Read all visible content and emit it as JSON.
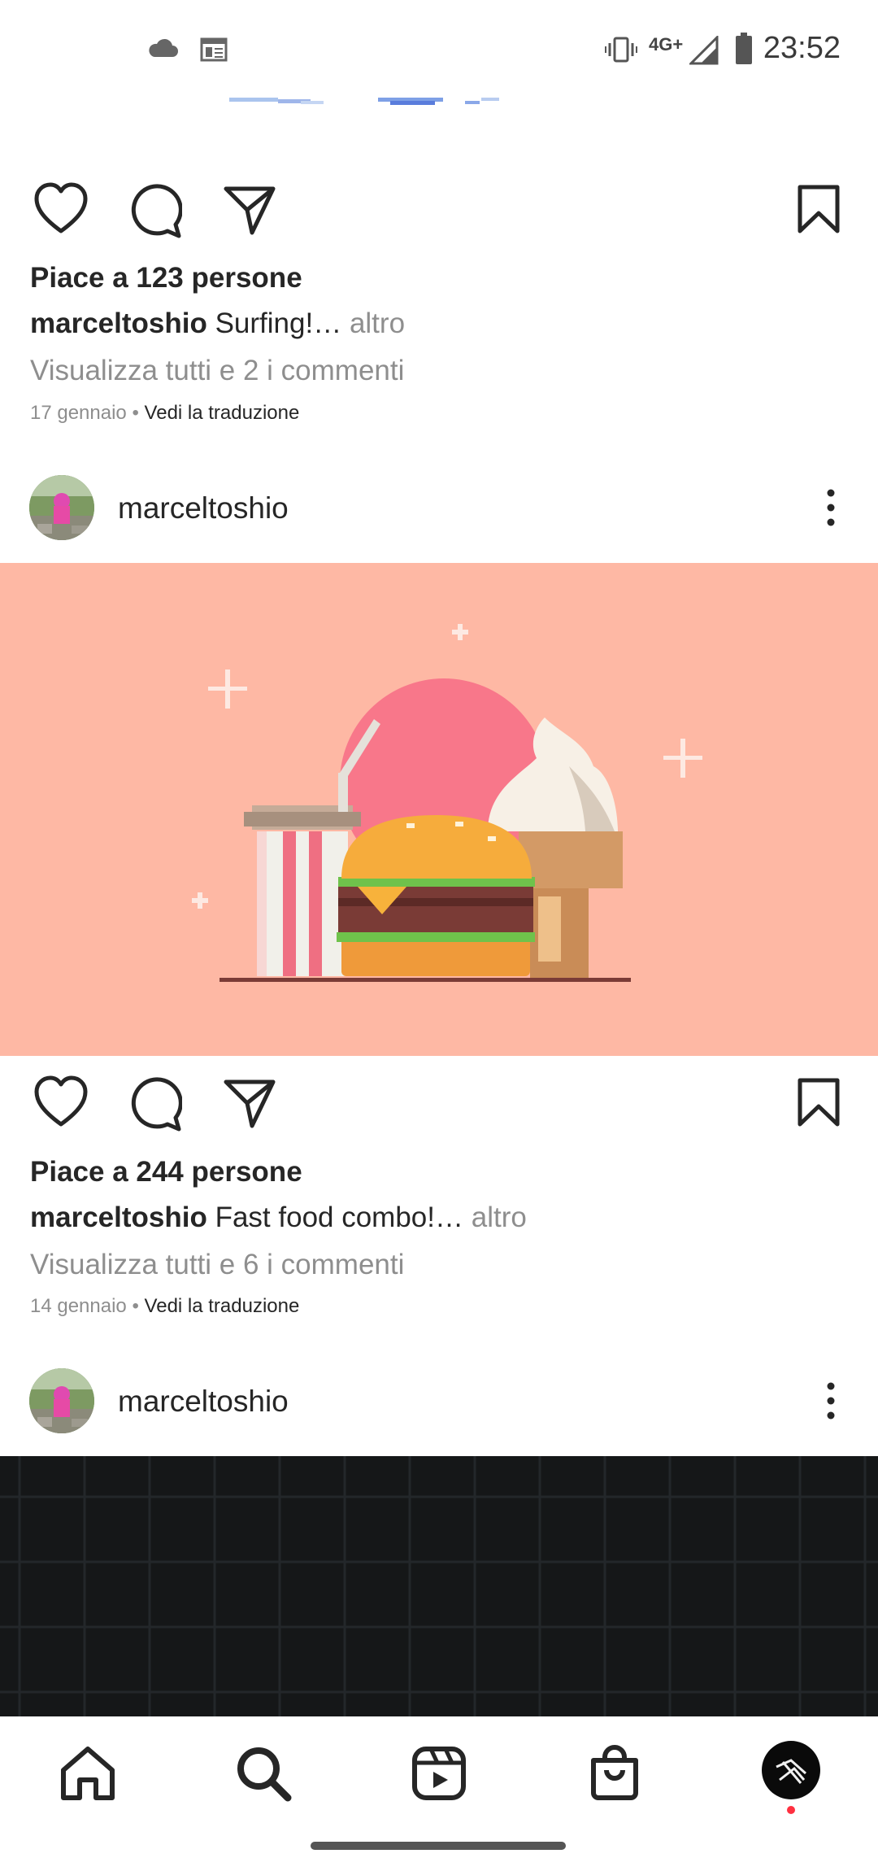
{
  "status_bar": {
    "time": "23:52",
    "network": "4G+",
    "icons": [
      "cloud-icon",
      "news-icon",
      "vibrate-icon",
      "signal-icon",
      "battery-icon"
    ]
  },
  "posts": [
    {
      "likes": "Piace a 123 persone",
      "caption_user": "marceltoshio",
      "caption_text": " Surfing!…",
      "caption_more": " altro",
      "comments": "Visualizza tutti e 2 i commenti",
      "date": "17 gennaio",
      "separator": " • ",
      "translate": "Vedi la traduzione"
    },
    {
      "username": "marceltoshio",
      "image_description_icon": "pixel-fast-food-image",
      "likes": "Piace a 244 persone",
      "caption_user": "marceltoshio",
      "caption_text": " Fast food combo!…",
      "caption_more": " altro",
      "comments": "Visualizza tutti e 6 i commenti",
      "date": "14 gennaio",
      "separator": " • ",
      "translate": "Vedi la traduzione"
    },
    {
      "username": "marceltoshio"
    }
  ],
  "nav": {
    "items": [
      "home-icon",
      "search-icon",
      "reels-icon",
      "shop-icon",
      "profile-avatar"
    ],
    "notification_color": "#ff3040"
  },
  "colors": {
    "image_bg": "#feb8a4",
    "dark_bg": "#151718"
  }
}
